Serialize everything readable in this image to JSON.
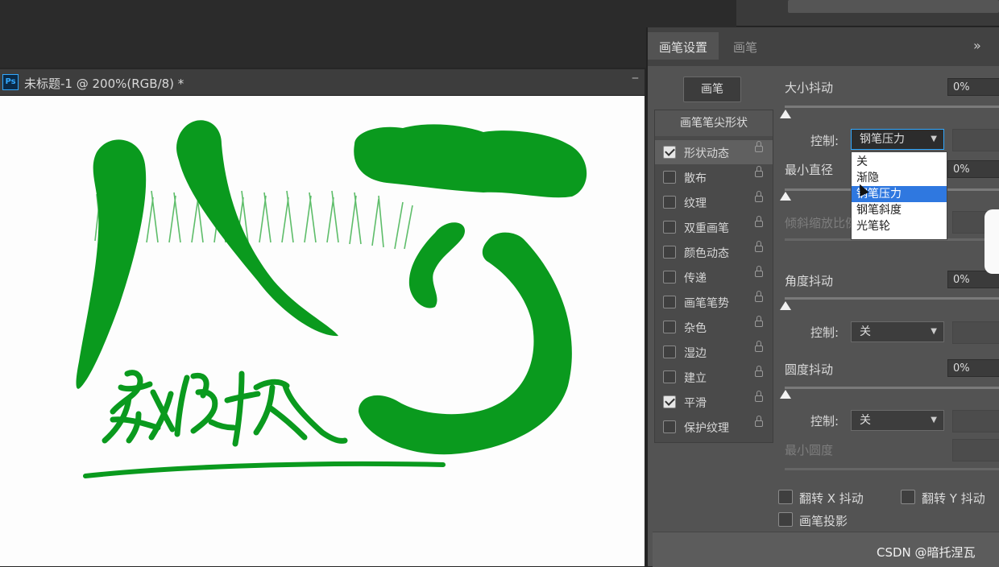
{
  "document": {
    "app_icon": "Ps",
    "title": "未标题-1 @ 200%(RGB/8) *",
    "minimize_glyph": "‒"
  },
  "panel": {
    "tabs": [
      "画笔设置",
      "画笔"
    ],
    "menu_glyph": "»",
    "presets_button": "画笔",
    "brush_tip_header": "画笔笔尖形状",
    "options": [
      {
        "label": "形状动态",
        "checked": true
      },
      {
        "label": "散布",
        "checked": false
      },
      {
        "label": "纹理",
        "checked": false
      },
      {
        "label": "双重画笔",
        "checked": false
      },
      {
        "label": "颜色动态",
        "checked": false
      },
      {
        "label": "传递",
        "checked": false
      },
      {
        "label": "画笔笔势",
        "checked": false
      },
      {
        "label": "杂色",
        "checked": false
      },
      {
        "label": "湿边",
        "checked": false
      },
      {
        "label": "建立",
        "checked": false
      },
      {
        "label": "平滑",
        "checked": true
      },
      {
        "label": "保护纹理",
        "checked": false
      }
    ],
    "size_jitter": {
      "label": "大小抖动",
      "value": "0%"
    },
    "control_label": "控制:",
    "size_control_value": "钢笔压力",
    "control_options": [
      "关",
      "渐隐",
      "钢笔压力",
      "钢笔斜度",
      "光笔轮"
    ],
    "highlighted_option_index": 2,
    "min_diameter": {
      "label": "最小直径",
      "value": "0%"
    },
    "tilt_scale": {
      "label": "倾斜缩放比例"
    },
    "angle_jitter": {
      "label": "角度抖动",
      "value": "0%"
    },
    "angle_control_value": "关",
    "roundness_jitter": {
      "label": "圆度抖动",
      "value": "0%"
    },
    "roundness_control_value": "关",
    "min_roundness": {
      "label": "最小圆度"
    },
    "flip_x": "翻转 X 抖动",
    "flip_y": "翻转 Y 抖动",
    "brush_projection": "画笔投影"
  },
  "watermark": "CSDN @暗托涅瓦",
  "colors": {
    "stroke": "#0a9a1e",
    "panel": "#535353",
    "highlight": "#2f78e0"
  }
}
